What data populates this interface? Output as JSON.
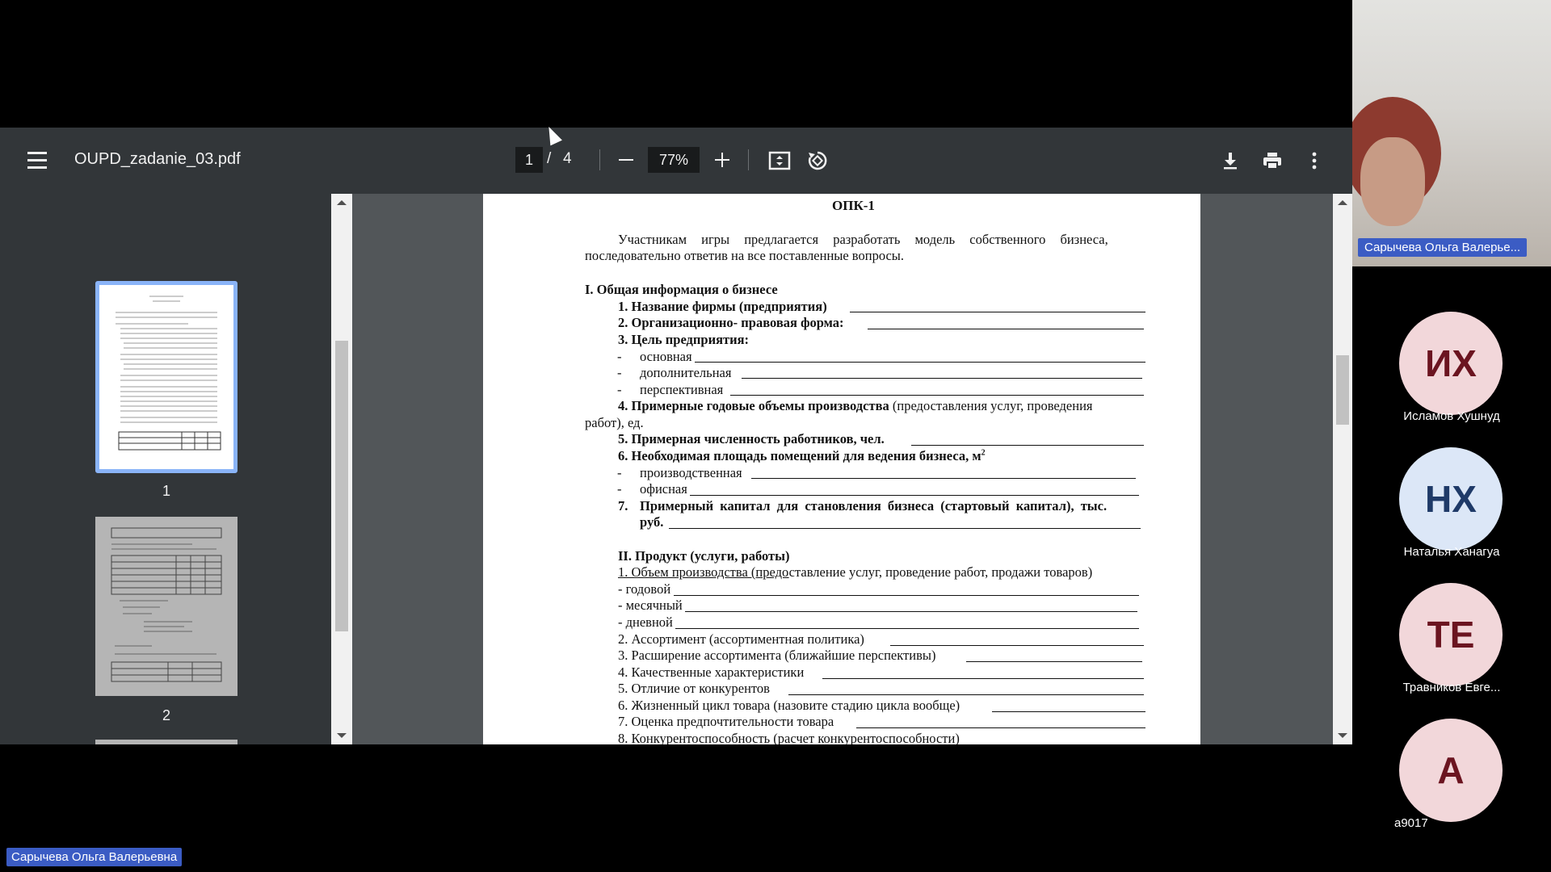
{
  "viewer": {
    "file_name": "OUPD_zadanie_03.pdf",
    "current_page": "1",
    "page_separator": "/",
    "total_pages": "4",
    "zoom": "77%"
  },
  "thumbnails": [
    {
      "label": "1"
    },
    {
      "label": "2"
    }
  ],
  "document": {
    "heading": "ОПК-1",
    "intro_1": "Участникам игры предлагается разработать модель собственного бизнеса,",
    "intro_2": "последовательно ответив на все поставленные вопросы.",
    "s1_title": "I. Общая информация о бизнесе",
    "s1_1": "1. Название фирмы (предприятия)",
    "s1_2": "2. Организационно- правовая форма:",
    "s1_3": "3. Цель предприятия:",
    "s1_3a": "основная",
    "s1_3b": "дополнительная",
    "s1_3c": "перспективная",
    "s1_4_bold": "4. Примерные годовые объемы производства",
    "s1_4_rest": "(предоставления услуг, проведения",
    "s1_4_cont": "работ), ед.",
    "s1_5": "5. Примерная численность работников, чел.",
    "s1_6": "6. Необходимая площадь помещений для ведения бизнеса, м",
    "s1_6_sup": "2",
    "s1_6a": "производственная",
    "s1_6b": "офисная",
    "s1_7_num": "7.",
    "s1_7a": "Примерный капитал для становления бизнеса (стартовый капитал), тыс.",
    "s1_7b": "руб.",
    "dash": "-",
    "s2_title": "II. Продукт (услуги, работы)",
    "s2_1_u": "1. Объем производства (предо",
    "s2_1_rest": "ставление услуг, проведение работ, продажи товаров)",
    "s2_1a": "- годовой",
    "s2_1b": "- месячный",
    "s2_1c": "- дневной",
    "s2_2": "2. Ассортимент (ассортиментная политика)",
    "s2_3": "3. Расширение ассортимента (ближайшие перспективы)",
    "s2_4": "4. Качественные характеристики",
    "s2_5": "5. Отличие от конкурентов",
    "s2_6": "6. Жизненный цикл товара (назовите стадию цикла вообще)",
    "s2_7": "7. Оценка предпочтительности товара",
    "s2_8": "8. Конкурентоспособность (расчет конкурентоспособности)"
  },
  "participants": [
    {
      "initials": "ИХ",
      "name": "Исламов Хушнуд",
      "bg": "#f2d7da",
      "fg": "#6b1420"
    },
    {
      "initials": "НХ",
      "name": "Наталья Ханагуа",
      "bg": "#dce7f7",
      "fg": "#1f3a68"
    },
    {
      "initials": "ТЕ",
      "name": "Травников Евге...",
      "bg": "#f2d7da",
      "fg": "#6b1420"
    },
    {
      "initials": "А",
      "name": "a9017",
      "bg": "#f2d7da",
      "fg": "#6b1420"
    }
  ],
  "camera_label": "Сарычева Ольга Валерье...",
  "speaker_label": "Сарычева Ольга Валерьевна",
  "colors": {
    "toolbar": "#323639",
    "viewer_bg": "#525659",
    "label_bg": "#3b5cc4",
    "thumb_highlight": "#8ab4f8"
  }
}
